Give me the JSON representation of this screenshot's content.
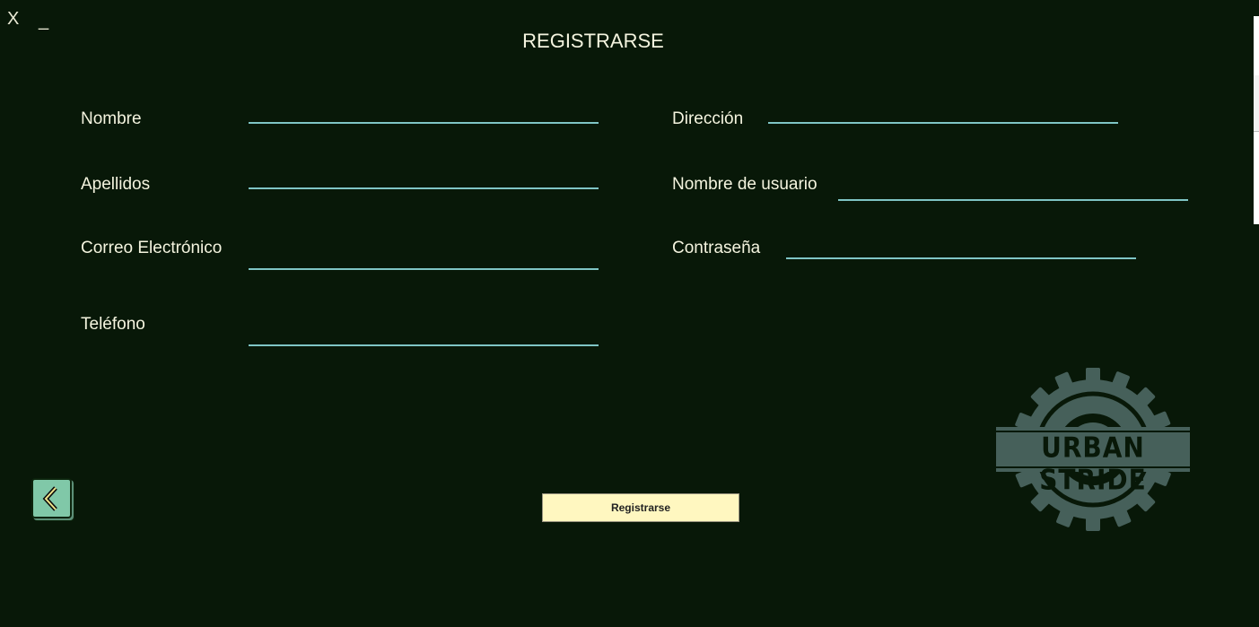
{
  "window": {
    "close_label": "X",
    "minimize_label": "_"
  },
  "title": "REGISTRARSE",
  "fields": {
    "nombre": {
      "label": "Nombre",
      "value": ""
    },
    "apellidos": {
      "label": "Apellidos",
      "value": ""
    },
    "correo": {
      "label": "Correo Electrónico",
      "value": ""
    },
    "telefono": {
      "label": "Teléfono",
      "value": ""
    },
    "direccion": {
      "label": "Dirección",
      "value": ""
    },
    "usuario": {
      "label": "Nombre de usuario",
      "value": ""
    },
    "contrasena": {
      "label": "Contraseña",
      "value": ""
    }
  },
  "buttons": {
    "submit_label": "Registrarse",
    "back_icon": "chevron-left-icon"
  },
  "logo": {
    "text": "URBAN STRIDE",
    "icon": "gear-badge-icon"
  },
  "colors": {
    "background": "#081808",
    "underline": "#7fc5c5",
    "button": "#fff7c0",
    "back_button": "#80c8a8",
    "logo": "#46605a"
  }
}
